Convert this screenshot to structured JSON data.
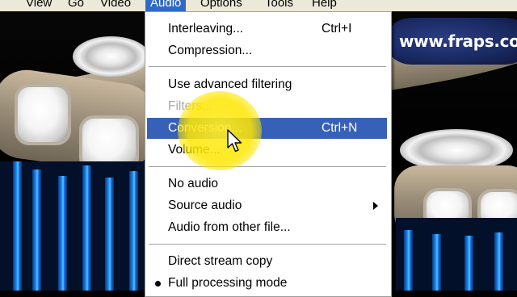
{
  "menubar": {
    "items": [
      {
        "label": "View"
      },
      {
        "label": "Go"
      },
      {
        "label": "Video"
      },
      {
        "label": "Audio"
      },
      {
        "label": "Options"
      },
      {
        "label": "Tools"
      },
      {
        "label": "Help"
      }
    ],
    "active": "Audio"
  },
  "audio_menu": {
    "items": [
      {
        "label": "Interleaving...",
        "shortcut": "Ctrl+I"
      },
      {
        "label": "Compression..."
      },
      {
        "label": "Use advanced filtering"
      },
      {
        "label": "Filters...",
        "state": "disabled"
      },
      {
        "label": "Conversion...",
        "shortcut": "Ctrl+N",
        "state": "highlighted"
      },
      {
        "label": "Volume..."
      },
      {
        "label": "No audio"
      },
      {
        "label": "Source audio",
        "submenu": true
      },
      {
        "label": "Audio from other file..."
      },
      {
        "label": "Direct stream copy"
      },
      {
        "label": "Full processing mode",
        "checked": true
      }
    ]
  },
  "watermark": "www.fraps.co",
  "colors": {
    "menu_highlight": "#3760b8",
    "menubar_bg": "#ece9d8",
    "cursor_highlight": "#ffe600"
  }
}
